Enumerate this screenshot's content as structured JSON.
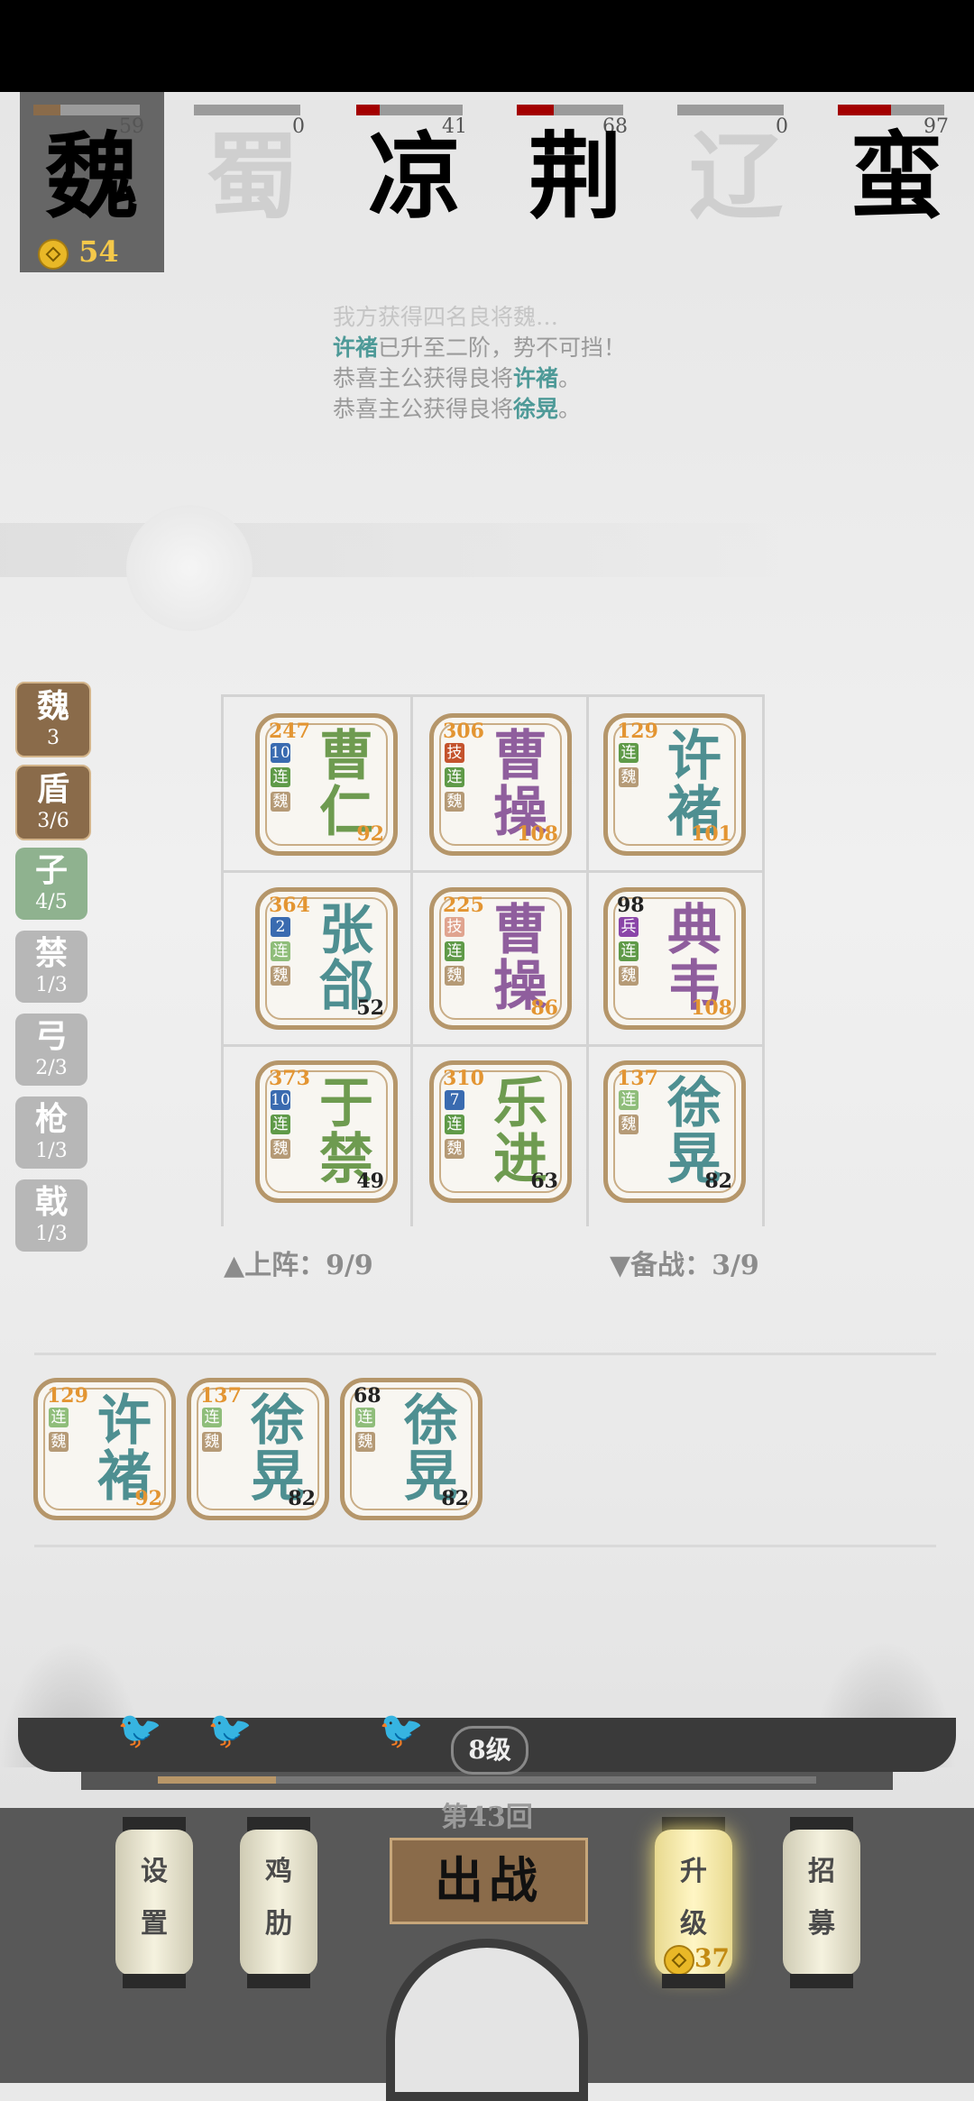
{
  "factions": [
    {
      "glyph": "魏",
      "value": "59",
      "fill": 0.25,
      "selected": true,
      "gold": "54"
    },
    {
      "glyph": "蜀",
      "value": "0",
      "fill": 0,
      "dim": true
    },
    {
      "glyph": "凉",
      "value": "41",
      "fill": 0.22
    },
    {
      "glyph": "荆",
      "value": "68",
      "fill": 0.35
    },
    {
      "glyph": "辽",
      "value": "0",
      "fill": 0,
      "dim": true
    },
    {
      "glyph": "蛮",
      "value": "97",
      "fill": 0.5
    }
  ],
  "log": {
    "line0": "我方获得四名良将魏…",
    "name1": "许褚",
    "line1": "已升至二阶，势不可挡！",
    "line2a": "恭喜主公获得良将",
    "name2": "许褚",
    "line2b": "。",
    "line3a": "恭喜主公获得良将",
    "name3": "徐晃",
    "line3b": "。"
  },
  "sidebar": [
    {
      "label": "魏",
      "count": "3",
      "state": "on"
    },
    {
      "label": "盾",
      "count": "3/6",
      "state": "on"
    },
    {
      "label": "子",
      "count": "4/5",
      "state": "mid"
    },
    {
      "label": "禁",
      "count": "1/3",
      "state": "off"
    },
    {
      "label": "弓",
      "count": "2/3",
      "state": "off"
    },
    {
      "label": "枪",
      "count": "1/3",
      "state": "off"
    },
    {
      "label": "戟",
      "count": "1/3",
      "state": "off"
    }
  ],
  "board": [
    {
      "n1": "曹",
      "n2": "仁",
      "power": "247",
      "level": "92",
      "color": "g",
      "lvcolor": "lvo",
      "tags": [
        [
          "10",
          "#3a6bb0"
        ],
        [
          "连",
          "#5f9a48"
        ],
        [
          "魏",
          "#b59a76"
        ]
      ]
    },
    {
      "n1": "曹",
      "n2": "操",
      "power": "306",
      "level": "108",
      "color": "p",
      "lvcolor": "lvo",
      "tags": [
        [
          "技",
          "#c4532d"
        ],
        [
          "连",
          "#5f9a48"
        ],
        [
          "魏",
          "#b59a76"
        ]
      ]
    },
    {
      "n1": "许",
      "n2": "褚",
      "power": "129",
      "level": "101",
      "color": "tl",
      "lvcolor": "lvo",
      "tags": [
        [
          "连",
          "#5f9a48"
        ],
        [
          "魏",
          "#b59a76"
        ]
      ]
    },
    {
      "n1": "张",
      "n2": "郃",
      "power": "364",
      "level": "52",
      "color": "tl",
      "lvcolor": "lvb",
      "tags": [
        [
          "2",
          "#3a6bb0"
        ],
        [
          "连",
          "#8fbd7a"
        ],
        [
          "魏",
          "#b59a76"
        ]
      ]
    },
    {
      "n1": "曹",
      "n2": "操",
      "power": "225",
      "level": "86",
      "color": "p",
      "lvcolor": "lvo",
      "tags": [
        [
          "技",
          "#e0a48f"
        ],
        [
          "连",
          "#5f9a48"
        ],
        [
          "魏",
          "#b59a76"
        ]
      ]
    },
    {
      "n1": "典",
      "n2": "韦",
      "power": "98",
      "level": "108",
      "color": "p",
      "lvcolor": "lvo",
      "powercolor": "#222",
      "tags": [
        [
          "兵",
          "#8a45a8"
        ],
        [
          "连",
          "#5f9a48"
        ],
        [
          "魏",
          "#b59a76"
        ]
      ]
    },
    {
      "n1": "于",
      "n2": "禁",
      "power": "373",
      "level": "49",
      "color": "g",
      "lvcolor": "lvb",
      "tags": [
        [
          "10",
          "#3a6bb0"
        ],
        [
          "连",
          "#5f9a48"
        ],
        [
          "魏",
          "#b59a76"
        ]
      ]
    },
    {
      "n1": "乐",
      "n2": "进",
      "power": "310",
      "level": "63",
      "color": "g",
      "lvcolor": "lvb",
      "tags": [
        [
          "7",
          "#3a6bb0"
        ],
        [
          "连",
          "#5f9a48"
        ],
        [
          "魏",
          "#b59a76"
        ]
      ]
    },
    {
      "n1": "徐",
      "n2": "晃",
      "power": "137",
      "level": "82",
      "color": "tl",
      "lvcolor": "lvb",
      "tags": [
        [
          "连",
          "#8fbd7a"
        ],
        [
          "魏",
          "#b59a76"
        ]
      ]
    }
  ],
  "deployed": "▲上阵：9/9",
  "reserve": "▼备战：3/9",
  "bench": [
    {
      "n1": "许",
      "n2": "褚",
      "power": "129",
      "level": "92",
      "color": "tl",
      "lvcolor": "lvo",
      "tags": [
        [
          "连",
          "#8fbd7a"
        ],
        [
          "魏",
          "#b59a76"
        ]
      ]
    },
    {
      "n1": "徐",
      "n2": "晃",
      "power": "137",
      "level": "82",
      "color": "tl",
      "lvcolor": "lvb",
      "tags": [
        [
          "连",
          "#8fbd7a"
        ],
        [
          "魏",
          "#b59a76"
        ]
      ]
    },
    {
      "n1": "徐",
      "n2": "晃",
      "power": "68",
      "level": "82",
      "color": "tl",
      "lvcolor": "lvb",
      "powercolor": "#222",
      "tags": [
        [
          "连",
          "#8fbd7a"
        ],
        [
          "魏",
          "#b59a76"
        ]
      ]
    }
  ],
  "bottom": {
    "level": "8级",
    "progress": 0.18,
    "round": "第43回",
    "fight": "出战",
    "settings": [
      "设",
      "置"
    ],
    "chicken": [
      "鸡",
      "肋"
    ],
    "upgrade": [
      "升",
      "级"
    ],
    "upgrade_cost": "37",
    "recruit": [
      "招",
      "募"
    ]
  }
}
